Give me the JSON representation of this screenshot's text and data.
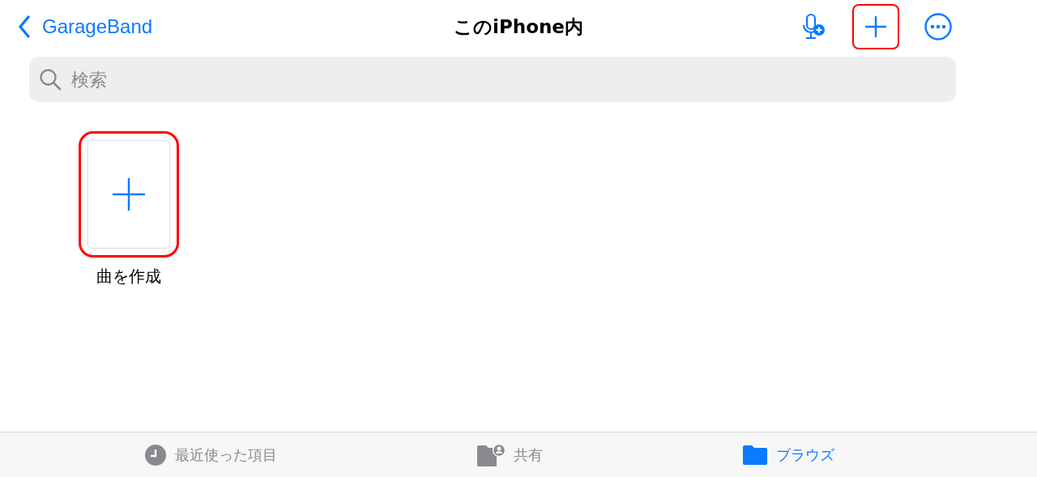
{
  "nav": {
    "back_label": "GarageBand",
    "title": "このiPhone内",
    "add_highlighted": true
  },
  "search": {
    "placeholder": "検索"
  },
  "items": [
    {
      "kind": "create",
      "label": "曲を作成",
      "highlighted": true
    }
  ],
  "tabs": [
    {
      "label": "最近使った項目",
      "kind": "clock",
      "selected": false
    },
    {
      "label": "共有",
      "kind": "shared",
      "selected": false
    },
    {
      "label": "ブラウズ",
      "kind": "folder",
      "selected": true
    }
  ]
}
